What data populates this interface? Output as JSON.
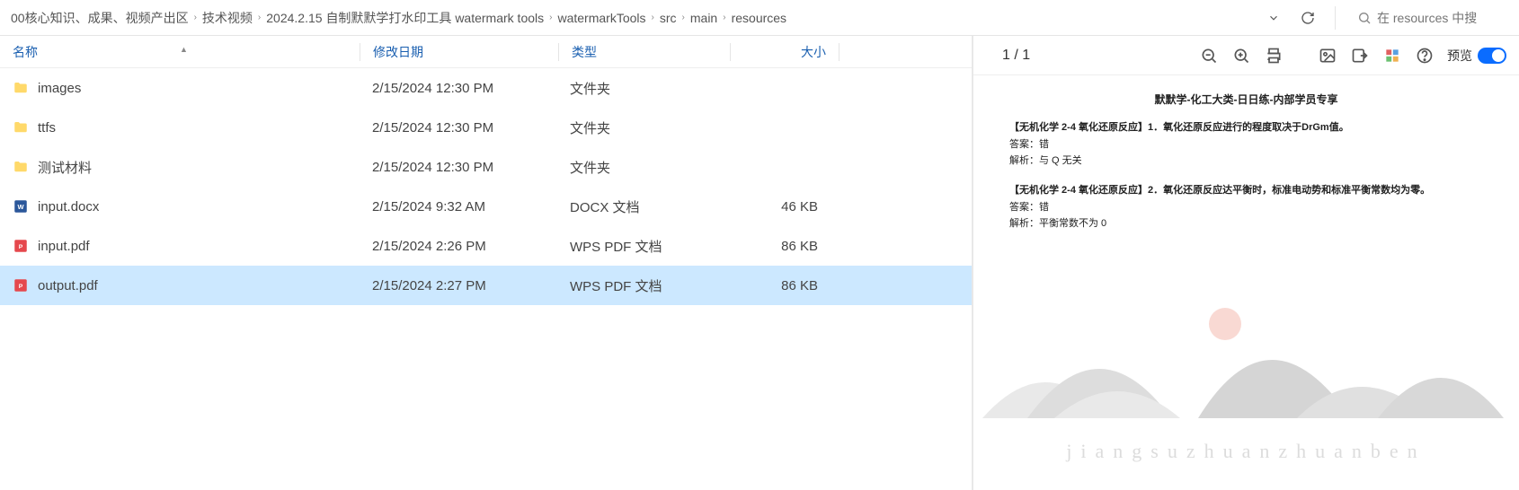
{
  "breadcrumbs": [
    "00核心知识、成果、视频产出区",
    "技术视频",
    "2024.2.15 自制默默学打水印工具 watermark tools",
    "watermarkTools",
    "src",
    "main",
    "resources"
  ],
  "search": {
    "placeholder": "在 resources 中搜"
  },
  "columns": {
    "name": "名称",
    "date": "修改日期",
    "type": "类型",
    "size": "大小"
  },
  "rows": [
    {
      "icon": "folder",
      "name": "images",
      "date": "2/15/2024 12:30 PM",
      "type": "文件夹",
      "size": "",
      "selected": false
    },
    {
      "icon": "folder",
      "name": "ttfs",
      "date": "2/15/2024 12:30 PM",
      "type": "文件夹",
      "size": "",
      "selected": false
    },
    {
      "icon": "folder",
      "name": "测试材料",
      "date": "2/15/2024 12:30 PM",
      "type": "文件夹",
      "size": "",
      "selected": false
    },
    {
      "icon": "docx",
      "name": "input.docx",
      "date": "2/15/2024 9:32 AM",
      "type": "DOCX 文档",
      "size": "46 KB",
      "selected": false
    },
    {
      "icon": "pdf",
      "name": "input.pdf",
      "date": "2/15/2024 2:26 PM",
      "type": "WPS PDF 文档",
      "size": "86 KB",
      "selected": false
    },
    {
      "icon": "pdf",
      "name": "output.pdf",
      "date": "2/15/2024 2:27 PM",
      "type": "WPS PDF 文档",
      "size": "86 KB",
      "selected": true
    }
  ],
  "preview": {
    "page_indicator": "1 / 1",
    "toggle_label": "预览",
    "doc_title": "默默学-化工大类-日日练-内部学员专享",
    "questions": [
      {
        "title": "【无机化学 2-4 氧化还原反应】1．氧化还原反应进行的程度取决于DrGm值。",
        "answer": "答案：错",
        "explain": "解析：与 Q 无关"
      },
      {
        "title": "【无机化学 2-4 氧化还原反应】2．氧化还原反应达平衡时，标准电动势和标准平衡常数均为零。",
        "answer": "答案：错",
        "explain": "解析：平衡常数不为 0"
      }
    ],
    "watermark_text": "jiangsuzhuanzhuanben"
  }
}
